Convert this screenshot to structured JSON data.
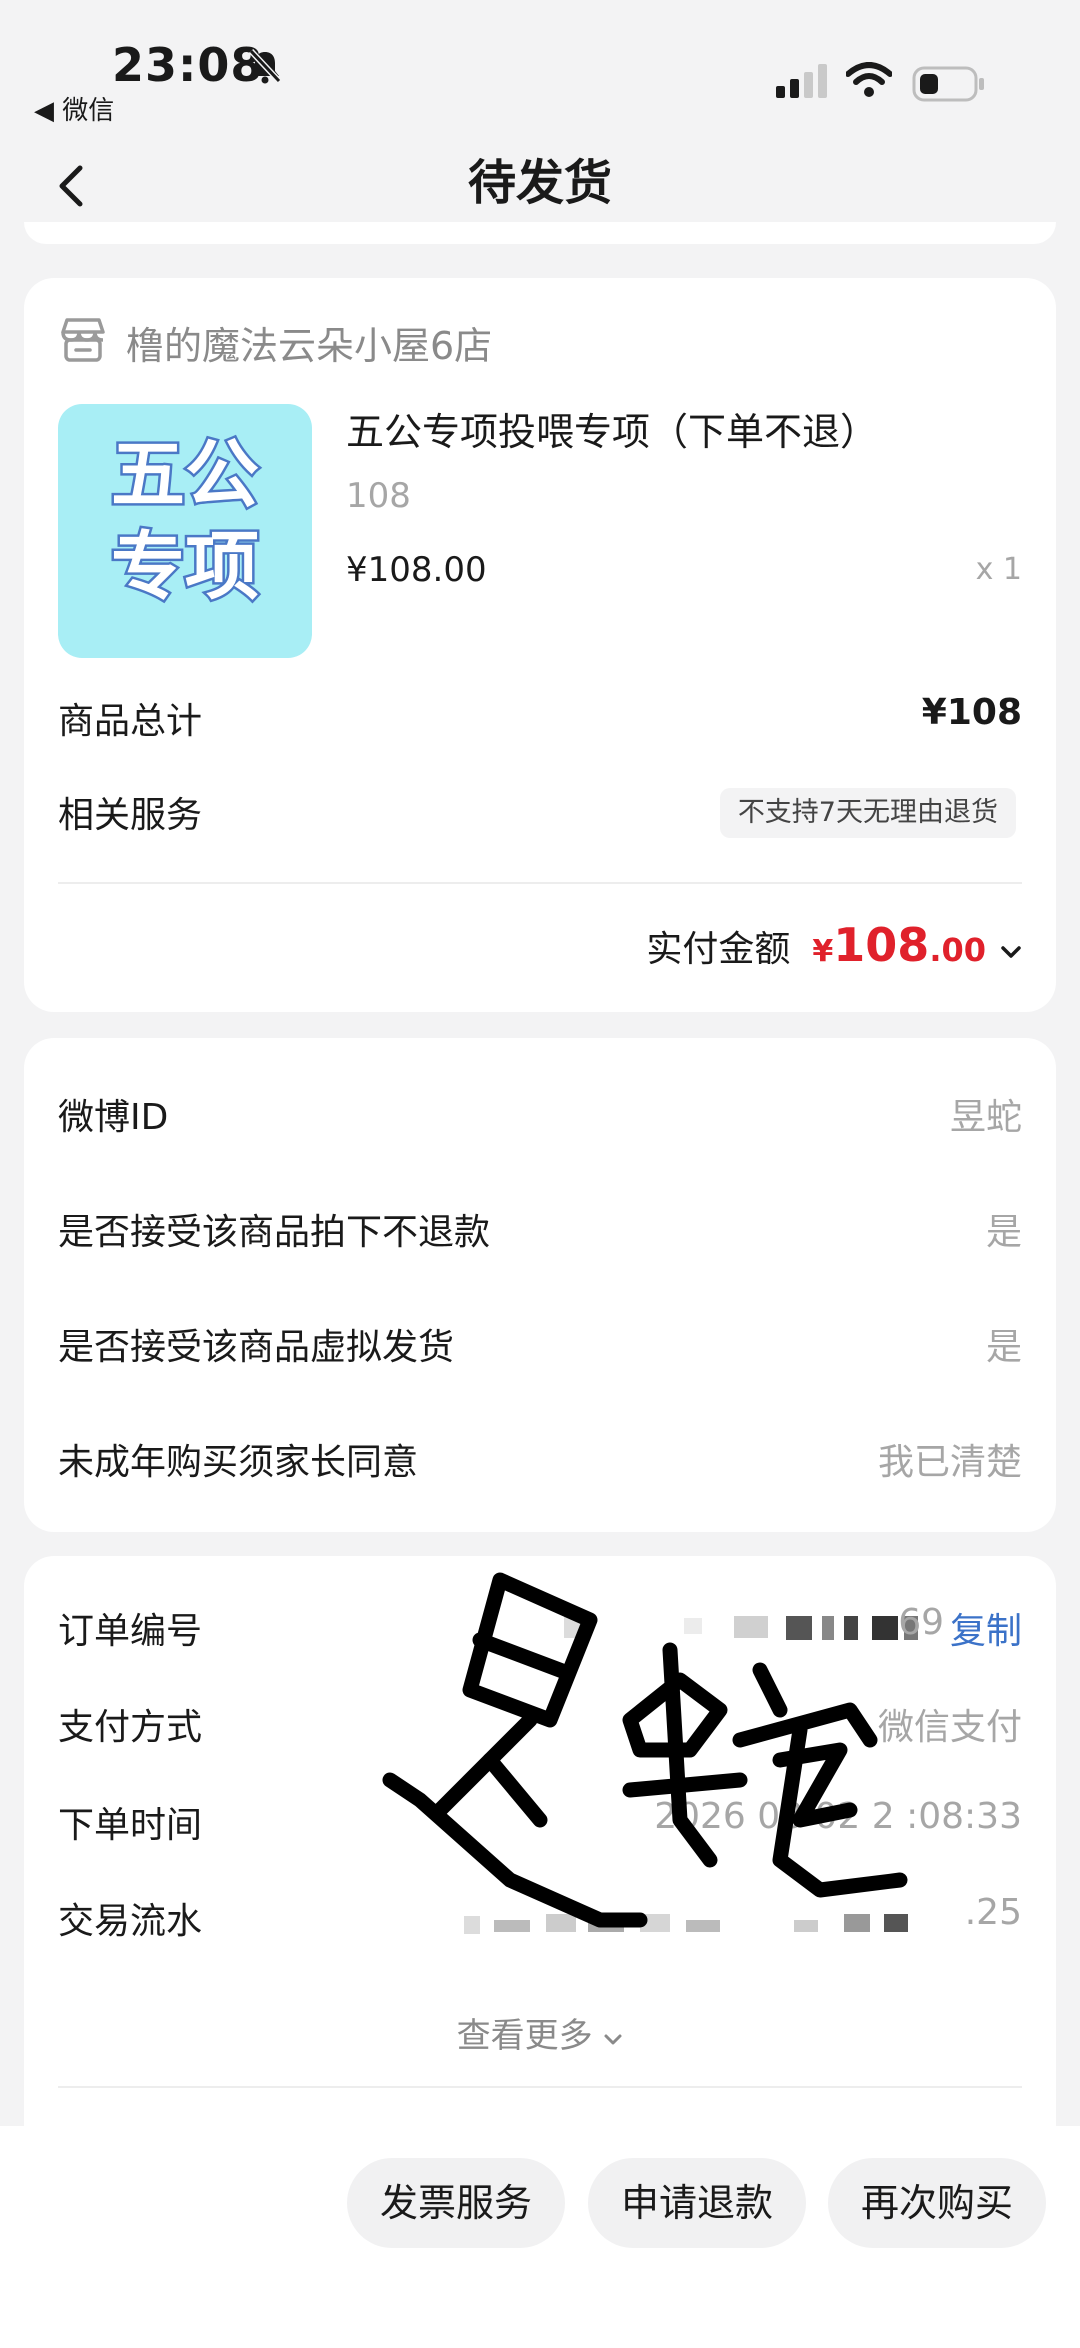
{
  "status_bar": {
    "time": "23:08",
    "back_app": "◀ 微信"
  },
  "nav": {
    "title": "待发货"
  },
  "order_card": {
    "shop_name": "橹的魔法云朵小屋6店",
    "product": {
      "thumb_line1": "五公",
      "thumb_line2": "专项",
      "title": "五公专项投喂专项（下单不退）",
      "spec": "108",
      "price": "¥108.00",
      "qty": "x 1"
    },
    "total_label": "商品总计",
    "total_value": "¥108",
    "service_label": "相关服务",
    "service_tag": "不支持7天无理由退货",
    "paid_label": "实付金额",
    "paid_currency": "¥",
    "paid_integer": "108",
    "paid_decimal": ".00"
  },
  "form_card": {
    "rows": [
      {
        "label": "微博ID",
        "value": "昱蛇"
      },
      {
        "label": "是否接受该商品拍下不退款",
        "value": "是"
      },
      {
        "label": "是否接受该商品虚拟发货",
        "value": "是"
      },
      {
        "label": "未成年购买须家长同意",
        "value": "我已清楚"
      }
    ]
  },
  "info_card": {
    "order_no_label": "订单编号",
    "order_no_tail": "69",
    "copy_label": "复制",
    "pay_method_label": "支付方式",
    "pay_method_value": "微信支付",
    "order_time_label": "下单时间",
    "order_time_value": "2026 08 02 2 :08:33",
    "txn_label": "交易流水",
    "txn_tail": ".25",
    "more_label": "查看更多"
  },
  "watermark": {
    "text": "昱蛇"
  },
  "bottom_bar": {
    "invoice": "发票服务",
    "refund": "申请退款",
    "rebuy": "再次购买"
  },
  "colors": {
    "accent_red": "#e0212b",
    "link_blue": "#3b72c8",
    "background": "#f3f3f4"
  }
}
